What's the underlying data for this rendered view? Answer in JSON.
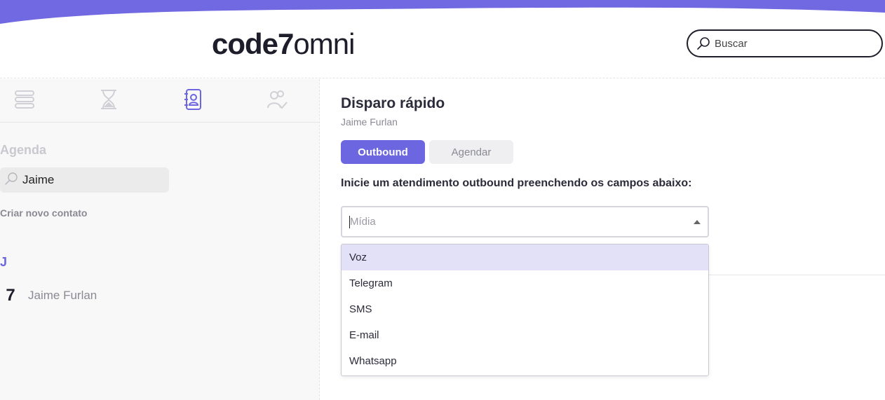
{
  "colors": {
    "accent": "#6c66e0",
    "top_band": "#7069e2",
    "dropdown_highlight": "#e3e1f7",
    "sidebar_bg": "#f8f8f8",
    "muted_text": "#8a8a94"
  },
  "header": {
    "logo_bold": "code7",
    "logo_light": "omni",
    "search": {
      "placeholder": "Buscar",
      "icon": "search-icon"
    }
  },
  "sidebar": {
    "tabs": [
      {
        "icon": "list-icon",
        "active": false
      },
      {
        "icon": "hourglass-icon",
        "active": false
      },
      {
        "icon": "address-book-icon",
        "active": true
      },
      {
        "icon": "user-check-icon",
        "active": false
      }
    ],
    "title": "Agenda",
    "search_value": "Jaime",
    "new_contact_label": "Criar novo contato",
    "groups": [
      {
        "letter": "J",
        "contacts": [
          {
            "avatar": "7",
            "name": "Jaime Furlan"
          }
        ]
      }
    ]
  },
  "main": {
    "title": "Disparo rápido",
    "subtitle": "Jaime Furlan",
    "tabs": [
      {
        "label": "Outbound",
        "active": true
      },
      {
        "label": "Agendar",
        "active": false
      }
    ],
    "instruction": "Inicie um atendimento outbound preenchendo os campos abaixo:",
    "media_select": {
      "placeholder": "Mídia",
      "options": [
        "Voz",
        "Telegram",
        "SMS",
        "E-mail",
        "Whatsapp"
      ],
      "highlighted": "Voz"
    }
  }
}
